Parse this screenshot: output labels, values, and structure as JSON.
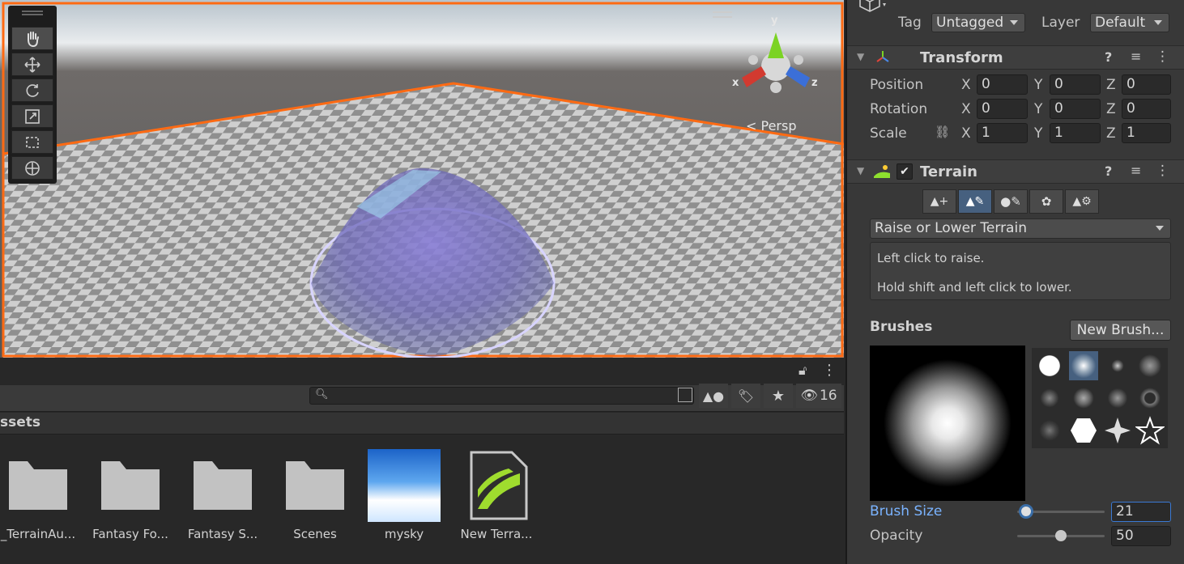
{
  "scene": {
    "persp_label": "< Persp",
    "gizmo_labels": {
      "x": "x",
      "y": "y",
      "z": "z"
    },
    "toolbar": {
      "tools": [
        "hand-icon",
        "move-icon",
        "rotate-icon",
        "scale-icon",
        "rect-icon",
        "transform-icon"
      ],
      "active_tool": "hand-icon"
    }
  },
  "project": {
    "search_placeholder": "",
    "hidden_count": "16",
    "breadcrumb": "ssets",
    "assets": [
      {
        "name": "_TerrainAu...",
        "type": "folder"
      },
      {
        "name": "Fantasy Fo...",
        "type": "folder"
      },
      {
        "name": "Fantasy S...",
        "type": "folder"
      },
      {
        "name": "Scenes",
        "type": "folder"
      },
      {
        "name": "mysky",
        "type": "texture"
      },
      {
        "name": "New Terra...",
        "type": "terrain-data"
      }
    ]
  },
  "inspector": {
    "tag_label": "Tag",
    "tag_value": "Untagged",
    "layer_label": "Layer",
    "layer_value": "Default",
    "transform": {
      "title": "Transform",
      "rows": [
        {
          "label": "Position",
          "x": "0",
          "y": "0",
          "z": "0"
        },
        {
          "label": "Rotation",
          "x": "0",
          "y": "0",
          "z": "0"
        },
        {
          "label": "Scale",
          "x": "1",
          "y": "1",
          "z": "1"
        }
      ],
      "axis": {
        "x": "X",
        "y": "Y",
        "z": "Z"
      }
    },
    "terrain": {
      "title": "Terrain",
      "enabled": true,
      "tool_dropdown": "Raise or Lower Terrain",
      "help_line1": "Left click to raise.",
      "help_line2": "Hold shift and left click to lower.",
      "brushes_label": "Brushes",
      "new_brush_button": "New Brush...",
      "brush_size_label": "Brush Size",
      "brush_size_value": "21",
      "brush_size_level": 0.1,
      "opacity_label": "Opacity",
      "opacity_value": "50",
      "opacity_level": 0.5
    }
  },
  "colors": {
    "accent": "#46607f",
    "selection_outline": "#ff6a13",
    "brush_label_blue": "#7ab3ff"
  }
}
